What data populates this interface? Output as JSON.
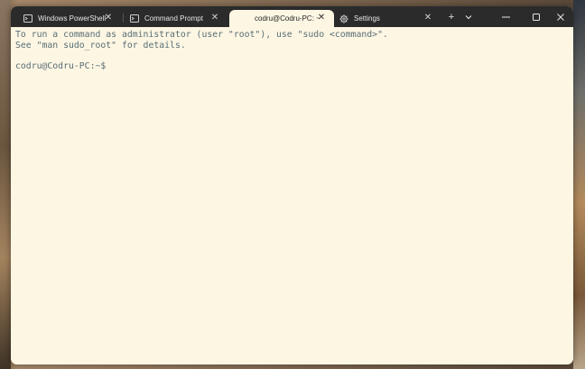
{
  "tabs": [
    {
      "label": "Windows PowerShell",
      "icon": "terminal-icon",
      "close": "✕",
      "active": false
    },
    {
      "label": "Command Prompt",
      "icon": "terminal-icon",
      "close": "✕",
      "active": false
    },
    {
      "label": "codru@Codru-PC: ~",
      "icon": "linux-icon",
      "close": "✕",
      "active": true
    },
    {
      "label": "Settings",
      "icon": "gear-icon",
      "close": "✕",
      "active": false
    }
  ],
  "toolbar": {
    "new_tab": "+",
    "dropdown": "⌄"
  },
  "window_controls": {
    "minimize": "—",
    "maximize": "☐",
    "close": "✕"
  },
  "terminal": {
    "lines": [
      "To run a command as administrator (user \"root\"), use \"sudo <command>\".",
      "See \"man sudo_root\" for details.",
      "",
      "codru@Codru-PC:~$"
    ],
    "background": "#fdf6e3",
    "foreground": "#586e75"
  }
}
